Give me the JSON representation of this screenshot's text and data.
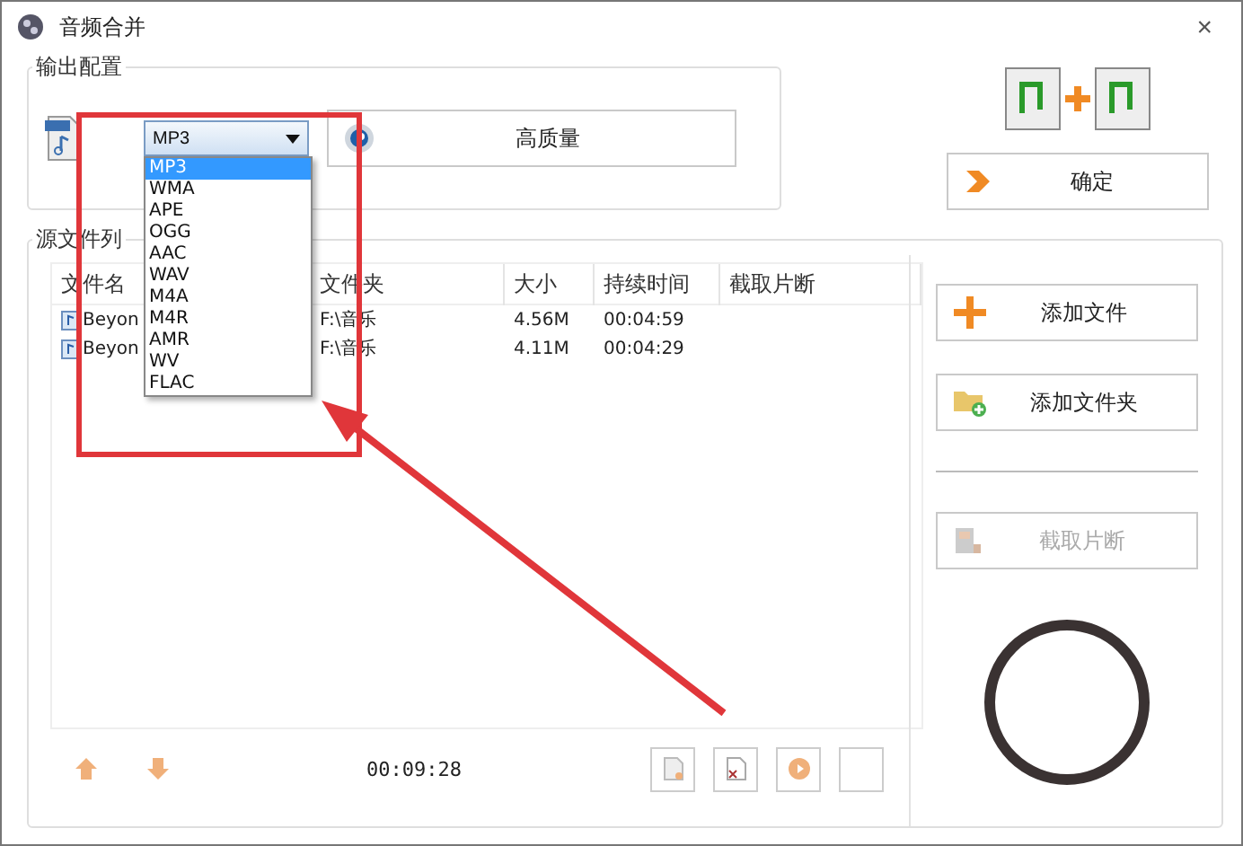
{
  "window": {
    "title": "音频合并",
    "close": "×"
  },
  "output_config": {
    "title": "输出配置",
    "format": {
      "value": "MP3",
      "options": [
        {
          "label": "MP3",
          "selected": true
        },
        {
          "label": "WMA",
          "selected": false
        },
        {
          "label": "APE",
          "selected": false
        },
        {
          "label": "OGG",
          "selected": false
        },
        {
          "label": "AAC",
          "selected": false
        },
        {
          "label": "WAV",
          "selected": false
        },
        {
          "label": "M4A",
          "selected": false
        },
        {
          "label": "M4R",
          "selected": false
        },
        {
          "label": "AMR",
          "selected": false
        },
        {
          "label": "WV",
          "selected": false
        },
        {
          "label": "FLAC",
          "selected": false
        }
      ]
    },
    "quality_button": "高质量"
  },
  "confirm_button": "确定",
  "source_list": {
    "title": "源文件列",
    "columns": [
      "文件名",
      "文件夹",
      "大小",
      "持续时间",
      "截取片断"
    ],
    "rows": [
      {
        "name": "Beyon",
        "folder": "F:\\音乐",
        "size": "4.56M",
        "duration": "00:04:59"
      },
      {
        "name": "Beyon",
        "folder": "F:\\音乐",
        "size": "4.11M",
        "duration": "00:04:29"
      }
    ],
    "total_duration": "00:09:28"
  },
  "side_buttons": [
    {
      "kind": "add-file",
      "label": "添加文件",
      "disabled": false
    },
    {
      "kind": "add-folder",
      "label": "添加文件夹",
      "disabled": false
    },
    {
      "kind": "clip",
      "label": "截取片断",
      "disabled": true
    }
  ]
}
